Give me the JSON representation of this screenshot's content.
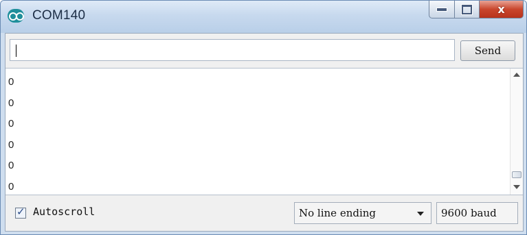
{
  "window": {
    "title": "COM140",
    "close_glyph": "x"
  },
  "toolbar": {
    "input_value": "",
    "send_label": "Send"
  },
  "output": {
    "lines": [
      "0",
      "0",
      "0",
      "0",
      "0",
      "0"
    ]
  },
  "footer": {
    "autoscroll_label": "Autoscroll",
    "autoscroll_checked": true,
    "line_ending_selected": "No line ending",
    "baud_selected": "9600 baud"
  },
  "icons": {
    "app": "arduino-icon",
    "minimize": "minimize-icon",
    "maximize": "maximize-icon",
    "close": "close-icon",
    "dropdown": "chevron-down-icon"
  },
  "colors": {
    "titlebar": "#c7d9ee",
    "close_button": "#c9462d",
    "app_icon": "#1f8f9b"
  }
}
